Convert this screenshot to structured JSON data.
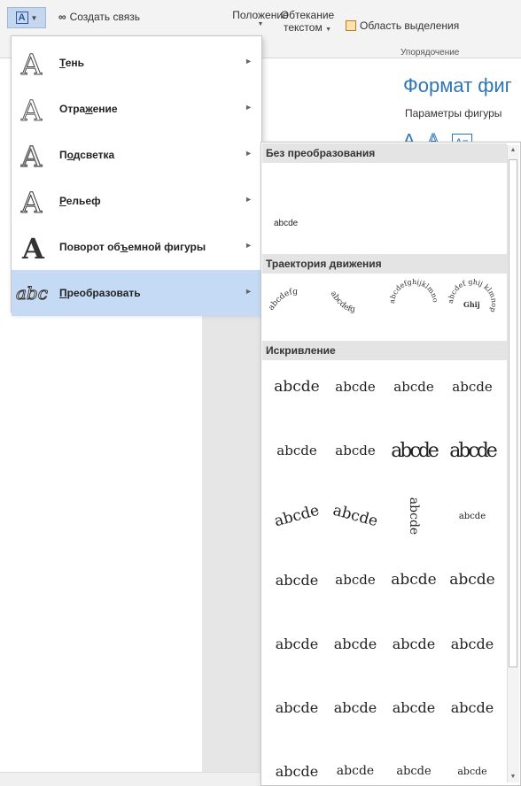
{
  "ribbon": {
    "create_link": "Создать связь",
    "position": "Положение",
    "wrap_line1": "Обтекание",
    "wrap_line2": "текстом",
    "selection_pane": "Область выделения",
    "group_arrange": "Упорядочение"
  },
  "pane": {
    "title": "Формат фиг",
    "subtitle": "Параметры фигуры"
  },
  "menu": {
    "items": [
      {
        "label": "Тень",
        "underline": "Т",
        "rest": "ень",
        "icon": "text-outline-a-icon"
      },
      {
        "label": "Отражение",
        "pre": "Отра",
        "underline": "ж",
        "rest": "ение",
        "icon": "text-reflection-a-icon"
      },
      {
        "label": "Подсветка",
        "pre": "П",
        "underline": "о",
        "rest": "дсветка",
        "icon": "text-glow-a-icon"
      },
      {
        "label": "Рельеф",
        "underline": "Р",
        "rest": "ельеф",
        "icon": "text-bevel-a-icon"
      },
      {
        "label": "Поворот объемной фигуры",
        "pre": "Поворот об",
        "underline": "ъ",
        "rest": "емной фигуры",
        "icon": "text-3d-rotation-a-icon"
      },
      {
        "label": "Преобразовать",
        "underline": "П",
        "rest": "реобразовать",
        "icon": "text-transform-abc-icon"
      }
    ]
  },
  "gallery": {
    "sections": [
      "Без преобразования",
      "Траектория движения",
      "Искривление"
    ],
    "plain_sample": "abcde",
    "path_samples": [
      "abcdefg",
      "abcdefg",
      "abcdefghijklmno",
      "abcdef ghij klmnop"
    ],
    "warp_rows": [
      [
        "abcde",
        "abcde",
        "abcde",
        "abcde"
      ],
      [
        "abcde",
        "abcde",
        "abcde",
        "abcde"
      ],
      [
        "abcde",
        "abcde",
        "abcde",
        "abcde"
      ],
      [
        "abcde",
        "abcde",
        "abcde",
        "abcde"
      ],
      [
        "abcde",
        "abcde",
        "abcde",
        "abcde"
      ],
      [
        "abcde",
        "abcde",
        "abcde",
        "abcde"
      ],
      [
        "abcde",
        "abcde",
        "abcde",
        "abcde"
      ]
    ]
  },
  "colors": {
    "accent": "#2e75b6",
    "selected": "#c5daf4",
    "header": "#e4e4e4"
  }
}
